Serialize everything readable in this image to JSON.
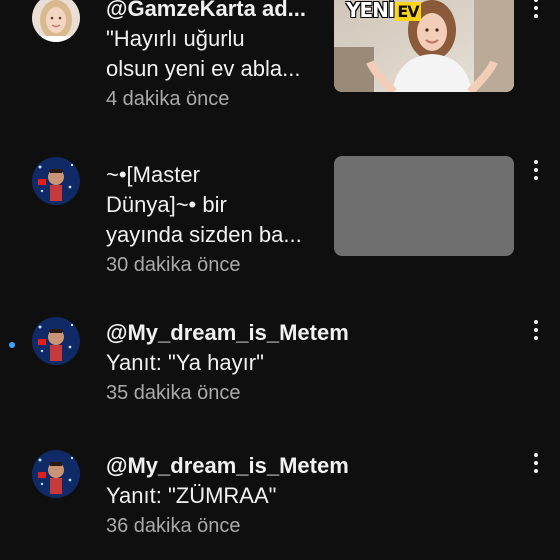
{
  "colors": {
    "background": "#0f0f0f",
    "text_primary": "#f1f1f1",
    "text_secondary": "#aaaaaa",
    "unread_dot": "#3ea6ff",
    "placeholder_thumb": "#6f6f6f"
  },
  "notifications": [
    {
      "title": "@GamzeKarta ad...",
      "body_lines": [
        "\"Hayırlı uğurlu",
        "olsun yeni ev abla..."
      ],
      "time": "4 dakika önce",
      "unread": false,
      "has_thumbnail": true,
      "thumbnail_text": "YENİ",
      "thumbnail_badge": "EV",
      "avatar_icon": "avatar-blonde-woman-icon",
      "menu_icon": "more-vert-icon"
    },
    {
      "title": "",
      "body_lines": [
        "~•[Master",
        "Dünya]~• bir",
        "yayında sizden ba..."
      ],
      "time": "30 dakika önce",
      "unread": false,
      "has_thumbnail": true,
      "avatar_icon": "avatar-starry-man-icon",
      "menu_icon": "more-vert-icon"
    },
    {
      "title": "@My_dream_is_Metem",
      "body_lines": [
        "Yanıt: \"Ya hayır\""
      ],
      "time": "35 dakika önce",
      "unread": true,
      "has_thumbnail": false,
      "avatar_icon": "avatar-starry-man-icon",
      "menu_icon": "more-vert-icon"
    },
    {
      "title": "@My_dream_is_Metem",
      "body_lines": [
        "Yanıt: \"ZÜMRAA\""
      ],
      "time": "36 dakika önce",
      "unread": false,
      "has_thumbnail": false,
      "avatar_icon": "avatar-starry-man-icon",
      "menu_icon": "more-vert-icon"
    }
  ]
}
